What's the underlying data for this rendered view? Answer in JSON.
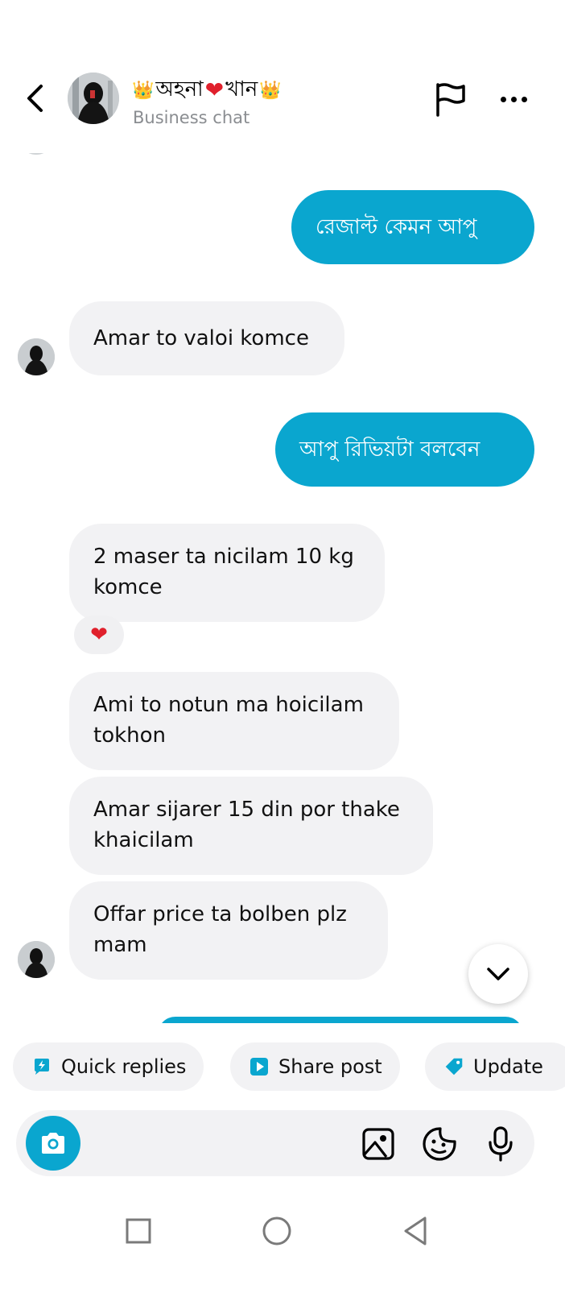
{
  "header": {
    "title_prefix": "👑",
    "title_name1": "অহনা",
    "title_heart": "❤",
    "title_name2": "খান",
    "title_suffix": "👑",
    "subtitle": "Business chat"
  },
  "messages": [
    {
      "direction": "out",
      "text": "রেজাল্ট কেমন আপু"
    },
    {
      "direction": "in",
      "text": "Amar to valoi komce"
    },
    {
      "direction": "out",
      "text": "আপু রিভিয়টা বলবেন"
    },
    {
      "direction": "in",
      "text": "2 maser ta nicilam 10 kg komce",
      "reaction": "❤"
    },
    {
      "direction": "in",
      "text": "Ami to notun ma hoicilam tokhon"
    },
    {
      "direction": "in",
      "text": "Amar sijarer 15 din por thake khaicilam"
    },
    {
      "direction": "in",
      "text": "Offar price ta bolben plz mam"
    }
  ],
  "chips": [
    {
      "label": "Quick replies",
      "icon": "lightning-icon"
    },
    {
      "label": "Share post",
      "icon": "play-icon"
    },
    {
      "label": "Update",
      "icon": "tag-icon"
    }
  ],
  "composer": {
    "placeholder": "",
    "icons": [
      "camera-icon",
      "gallery-icon",
      "sticker-icon",
      "microphone-icon"
    ]
  },
  "colors": {
    "accent": "#0aa6cf",
    "incoming_bubble": "#f2f2f4",
    "heart": "#e0202c"
  }
}
